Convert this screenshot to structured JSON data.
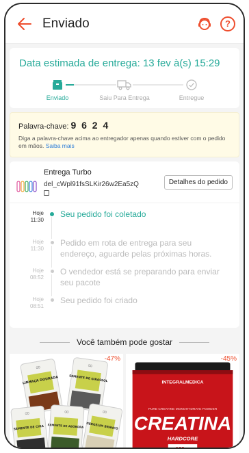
{
  "header": {
    "title": "Enviado",
    "back_icon": "arrow-left-icon",
    "support_icon": "headset-icon",
    "help_icon": "question-icon",
    "help_glyph": "?",
    "accent": "#ee4d2d"
  },
  "eta": {
    "title": "Data estimada de entrega: 13 fev à(s) 15:29",
    "color": "#26aa99",
    "steps": [
      {
        "label": "Enviado",
        "icon": "box-icon",
        "active": true
      },
      {
        "label": "Saiu Para Entrega",
        "icon": "truck-icon",
        "active": false
      },
      {
        "label": "Entregue",
        "icon": "check-circle-icon",
        "active": false
      }
    ]
  },
  "keyword": {
    "label": "Palavra-chave:",
    "code": "9 6 2 4",
    "note": "Diga a palavra-chave acima ao entregador apenas quando estiver com o pedido em mãos.",
    "link": "Saiba mais"
  },
  "shipment": {
    "carrier": "Entrega Turbo",
    "tracking_code": "del_cWpl91fsSLKir26w2Ea5zQ",
    "details_button": "Detalhes do pedido"
  },
  "timeline": [
    {
      "day": "Hoje",
      "time": "11:30",
      "text": "Seu pedido foi coletado",
      "active": true
    },
    {
      "day": "Hoje",
      "time": "11:30",
      "text": "Pedido em rota de entrega para seu endereço, aguarde pelas próximas horas.",
      "active": false
    },
    {
      "day": "Hoje",
      "time": "08:52",
      "text": "O vendedor está se preparando para enviar seu pacote",
      "active": false
    },
    {
      "day": "Hoje",
      "time": "08:51",
      "text": "Seu pedido foi criado",
      "active": false
    }
  ],
  "recommendations": {
    "title": "Você também pode gostar",
    "products": [
      {
        "discount": "-47%",
        "brand_logo": "∞",
        "bags": [
          {
            "label": "LINHAÇA DOURADA",
            "color": "#7a3a18"
          },
          {
            "label": "SEMENTE DE GIRASSOL",
            "color": "#5a5a5a"
          },
          {
            "label": "SEMENTE DE CHIA",
            "color": "#2f2f2f"
          },
          {
            "label": "SEMENTE DE ABÓBORA",
            "color": "#3c5b2a"
          },
          {
            "label": "GERGELIM BRANCO",
            "color": "#d8cfb5"
          }
        ]
      },
      {
        "discount": "-45%",
        "brand": "INTEGRALMEDICA",
        "tagline": "PURE CREATINE MONOHYDRATE POWDER",
        "product_name": "CREATINA",
        "variant": "HARDCORE",
        "amount": "100",
        "unit": "g"
      }
    ]
  }
}
